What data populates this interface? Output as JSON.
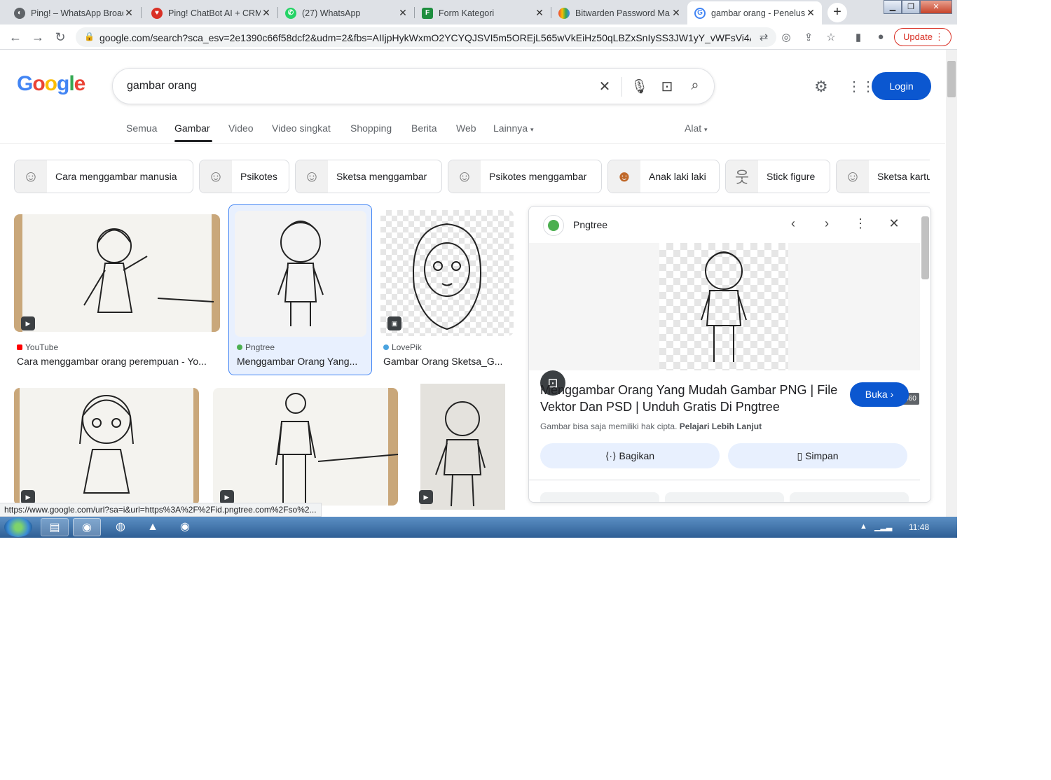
{
  "browser": {
    "tabs": [
      {
        "title": "Ping! – WhatsApp Broad",
        "icon": "ping-icon",
        "color": "#5f6368"
      },
      {
        "title": "Ping! ChatBot AI + CRM",
        "icon": "heart-chat-icon",
        "color": "#d93025"
      },
      {
        "title": "(27) WhatsApp",
        "icon": "whatsapp-icon",
        "color": "#25d366"
      },
      {
        "title": "Form Kategori",
        "icon": "form-icon",
        "color": "#1e8e3e"
      },
      {
        "title": "Bitwarden Password Ma",
        "icon": "rainbow-icon",
        "color": "#4285f4"
      },
      {
        "title": "gambar orang - Penelus",
        "icon": "google-icon",
        "color": "#4285f4"
      }
    ],
    "url": "google.com/search?sca_esv=2e1390c66f58dcf2&udm=2&fbs=AIIjpHykWxmO2YCYQJSVI5m5OREjL565wVkEiHz50qLBZxSnIySS3JW1yY_vWFsVi4ACAV...",
    "update_label": "Update",
    "status_url": "https://www.google.com/url?sa=i&url=https%3A%2F%2Fid.pngtree.com%2Fso%2..."
  },
  "header": {
    "logo": "Google",
    "query": "gambar orang",
    "login_label": "Login"
  },
  "nav": {
    "tabs": [
      "Semua",
      "Gambar",
      "Video",
      "Video singkat",
      "Shopping",
      "Berita",
      "Web",
      "Lainnya"
    ],
    "tools": "Alat"
  },
  "chips": [
    "Cara menggambar manusia",
    "Psikotes",
    "Sketsa menggambar",
    "Psikotes menggambar",
    "Anak laki laki",
    "Stick figure",
    "Sketsa kartu"
  ],
  "results": [
    {
      "source": "YouTube",
      "caption": "Cara menggambar orang perempuan - Yo..."
    },
    {
      "source": "Pngtree",
      "caption": "Menggambar Orang Yang..."
    },
    {
      "source": "LovePik",
      "caption": "Gambar Orang Sketsa_G..."
    }
  ],
  "panel": {
    "source": "Pngtree",
    "dims": "360 × 360",
    "title": "Menggambar Orang Yang Mudah Gambar PNG | File Vektor Dan PSD | Unduh Gratis Di Pngtree",
    "open_label": "Buka",
    "copyright": "Gambar bisa saja memiliki hak cipta.",
    "learn_more": "Pelajari Lebih Lanjut",
    "share_label": "Bagikan",
    "save_label": "Simpan"
  },
  "taskbar": {
    "clock": "11:48"
  }
}
